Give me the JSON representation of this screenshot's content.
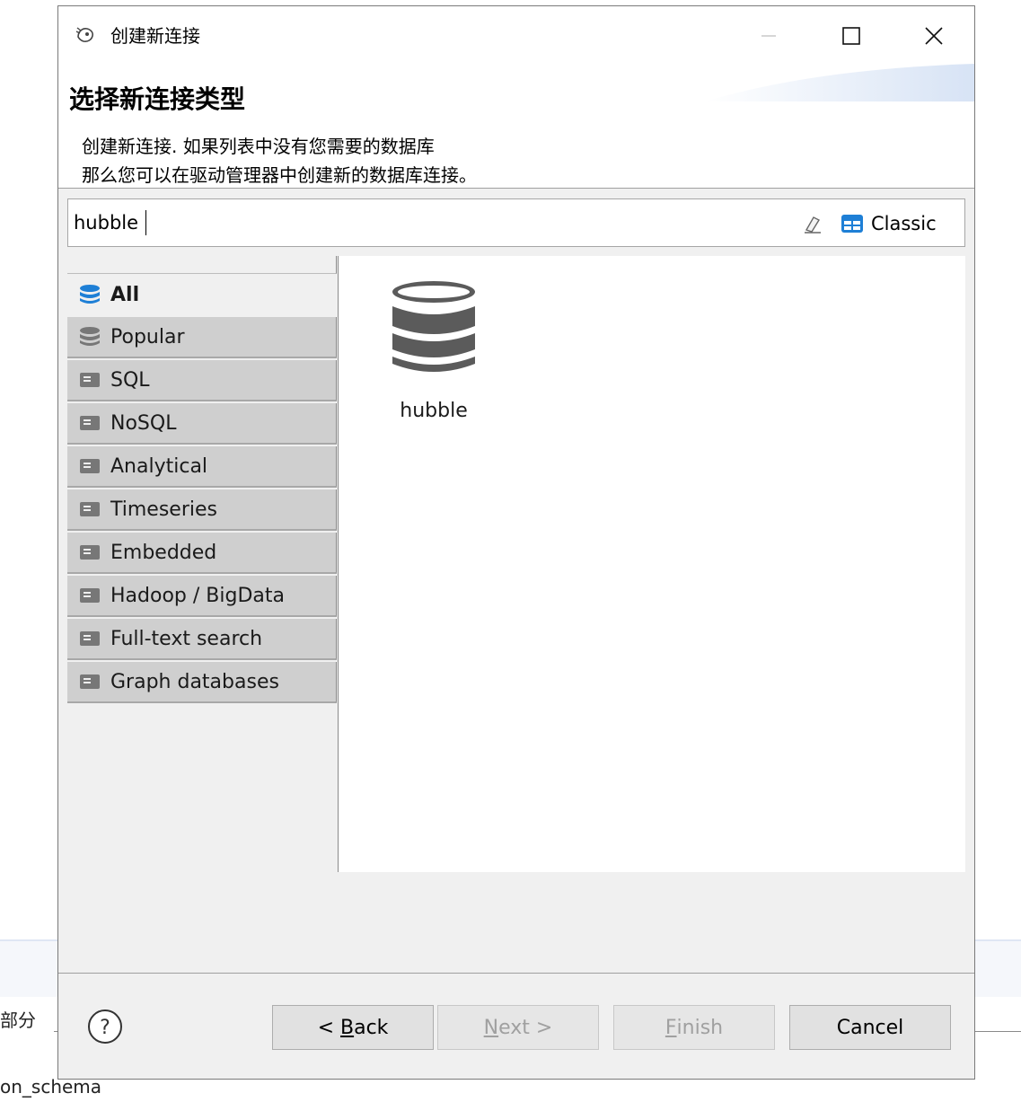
{
  "background": {
    "fragment_1": "部分",
    "fragment_2": "on_schema"
  },
  "dialog": {
    "title": "创建新连接",
    "window_controls": {
      "minimize": "—",
      "maximize": "□",
      "close": "✕"
    },
    "header": {
      "title": "选择新连接类型",
      "description_line1": "创建新连接. 如果列表中没有您需要的数据库",
      "description_line2": "那么您可以在驱动管理器中创建新的数据库连接。"
    },
    "search": {
      "value": "hubble",
      "classic_label": "Classic"
    },
    "categories": [
      {
        "label": "All",
        "icon": "database-stack-icon",
        "selected": true
      },
      {
        "label": "Popular",
        "icon": "database-stack-icon",
        "selected": false
      },
      {
        "label": "SQL",
        "icon": "folder-db-icon",
        "selected": false
      },
      {
        "label": "NoSQL",
        "icon": "folder-db-icon",
        "selected": false
      },
      {
        "label": "Analytical",
        "icon": "folder-db-icon",
        "selected": false
      },
      {
        "label": "Timeseries",
        "icon": "folder-db-icon",
        "selected": false
      },
      {
        "label": "Embedded",
        "icon": "folder-db-icon",
        "selected": false
      },
      {
        "label": "Hadoop / BigData",
        "icon": "folder-db-icon",
        "selected": false
      },
      {
        "label": "Full-text search",
        "icon": "folder-db-icon",
        "selected": false
      },
      {
        "label": "Graph databases",
        "icon": "folder-db-icon",
        "selected": false
      }
    ],
    "drivers": [
      {
        "label": "hubble",
        "icon": "database-icon"
      }
    ],
    "buttons": {
      "back_prefix": "< ",
      "back_mnemonic": "B",
      "back_rest": "ack",
      "next_mnemonic": "N",
      "next_rest": "ext >",
      "finish_mnemonic": "F",
      "finish_rest": "inish",
      "cancel": "Cancel",
      "help": "?"
    },
    "colors": {
      "accent": "#1e7fd6",
      "category_bg": "#cfcfcf",
      "dialog_bg": "#f0f0f0"
    }
  }
}
